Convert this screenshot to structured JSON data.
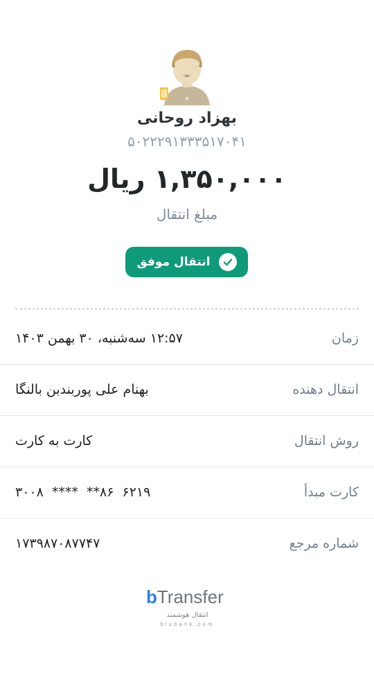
{
  "recipient": {
    "name": "بهزاد روحانی",
    "card_number": "۵۰۲۲۲۹۱۳۳۳۵۱۷۰۴۱"
  },
  "amount": {
    "value": "۱,۳۵۰,۰۰۰ ریال",
    "label": "مبلغ انتقال"
  },
  "status": {
    "label": "انتقال موفق",
    "color": "#0f9a7a"
  },
  "details": [
    {
      "key": "زمان",
      "value": "۱۲:۵۷ سه‌شنبه، ۳۰ بهمن ۱۴۰۳"
    },
    {
      "key": "انتقال دهنده",
      "value": "بهنام علی پوربندبن بالنگا"
    },
    {
      "key": "روش انتقال",
      "value": "کارت به کارت"
    },
    {
      "key": "کارت مبدأ",
      "value": "۶۲۱۹  ۸۶**  ****  ۳۰۰۸"
    },
    {
      "key": "شماره مرجع",
      "value": "۱۷۳۹۸۷۰۸۷۷۴۷"
    }
  ],
  "logo": {
    "brand_b": "b",
    "brand_rest": "Transfer",
    "tagline": "انتقال هوشمند",
    "site": "blubank.com"
  },
  "icons": {
    "avatar": "avatar-man",
    "status": "check-icon"
  }
}
